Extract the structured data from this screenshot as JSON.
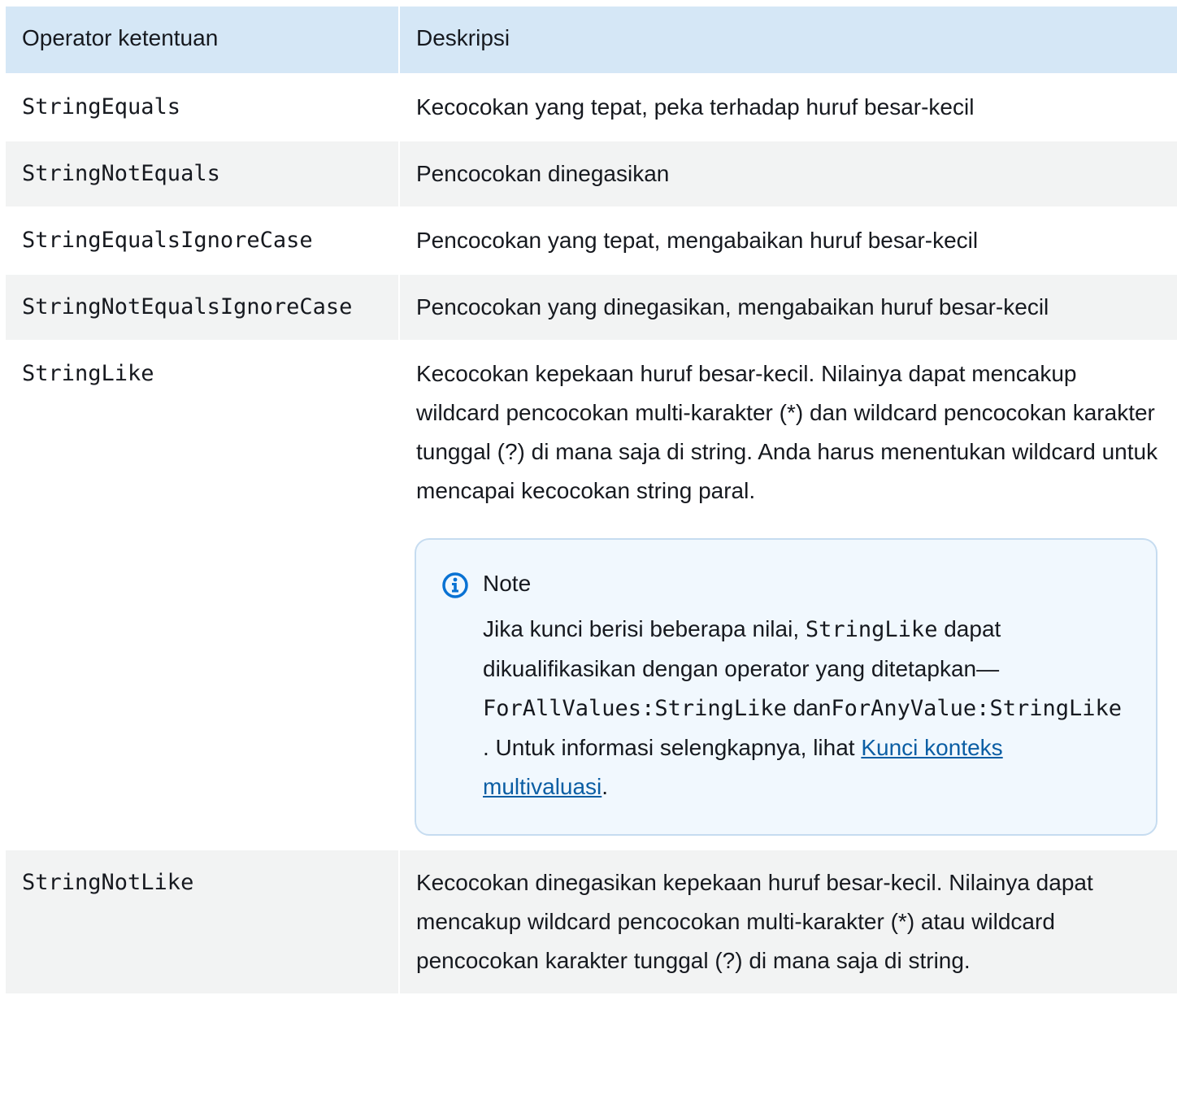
{
  "table": {
    "headers": {
      "operator": "Operator ketentuan",
      "description": "Deskripsi"
    },
    "rows": [
      {
        "operator": "StringEquals",
        "description": "Kecocokan yang tepat, peka terhadap huruf besar-kecil"
      },
      {
        "operator": "StringNotEquals",
        "description": "Pencocokan dinegasikan"
      },
      {
        "operator": "StringEqualsIgnoreCase",
        "description": "Pencocokan yang tepat, mengabaikan huruf besar-kecil"
      },
      {
        "operator": "StringNotEqualsIgnoreCase",
        "description": "Pencocokan yang dinegasikan, mengabaikan huruf besar-kecil"
      },
      {
        "operator": "StringLike",
        "description": "Kecocokan kepekaan huruf besar-kecil. Nilainya dapat mencakup wildcard pencocokan multi-karakter (*) dan wildcard pencocokan karakter tunggal (?) di mana saja di string. Anda harus menentukan wildcard untuk mencapai kecocokan string paral."
      },
      {
        "operator": "StringNotLike",
        "description": "Kecocokan dinegasikan kepekaan huruf besar-kecil. Nilainya dapat mencakup wildcard pencocokan multi-karakter (*) atau wildcard pencocokan karakter tunggal (?) di mana saja di string."
      }
    ]
  },
  "note": {
    "icon": "info-icon",
    "title": "Note",
    "text_part1": "Jika kunci berisi beberapa nilai, ",
    "code1": "StringLike",
    "text_part2": " dapat dikualifikasikan dengan operator yang ditetapkan—",
    "code2": "ForAllValues:StringLike",
    "text_part3": " dan",
    "code3": "ForAnyValue:StringLike",
    "text_part4": " . Untuk informasi selengkapnya, lihat ",
    "link_text": "Kunci konteks multivaluasi",
    "text_part5": "."
  },
  "colors": {
    "header_bg": "#d5e7f6",
    "row_alt_bg": "#f2f3f3",
    "note_bg": "#f1f8fe",
    "note_border": "#c6dcf0",
    "link": "#0b5ea4",
    "info_icon": "#0972d3"
  }
}
